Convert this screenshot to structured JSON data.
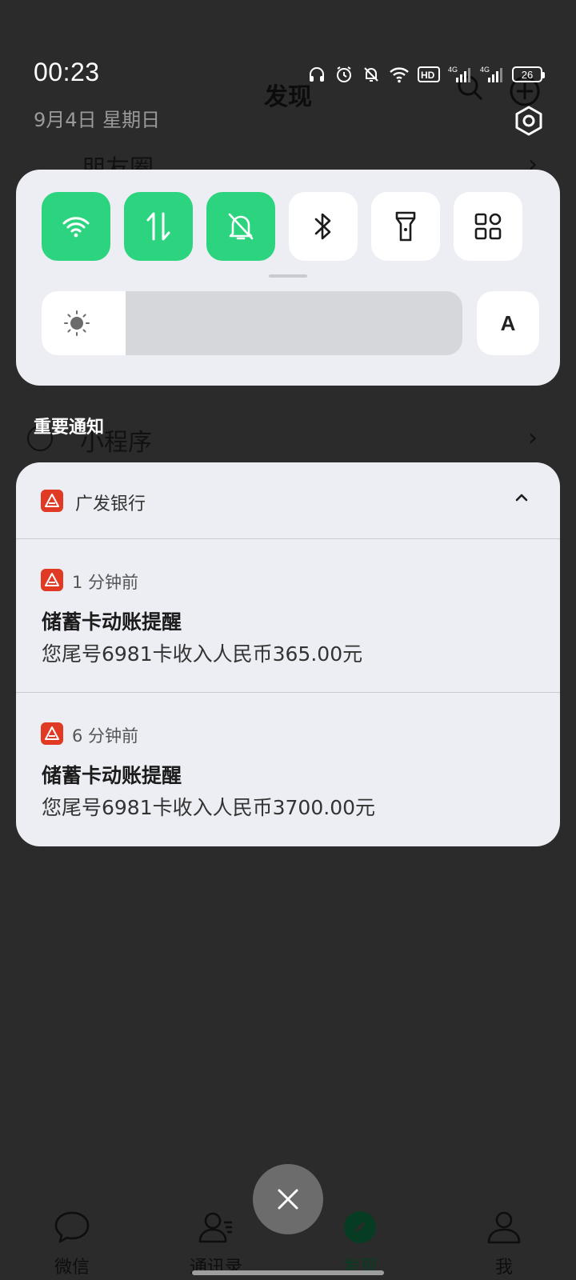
{
  "background_app": {
    "title": "发现",
    "rows": [
      {
        "label": "朋友圈"
      },
      {
        "label": "小程序"
      }
    ]
  },
  "status_bar": {
    "time": "00:23",
    "date": "9月4日  星期日",
    "battery": "26",
    "network_1": "4G",
    "network_2": "4G",
    "hd_badge": "HD"
  },
  "quick_settings": {
    "tiles": [
      {
        "name": "wifi",
        "active": true,
        "icon": "wifi-icon"
      },
      {
        "name": "mobile-data",
        "active": true,
        "icon": "data-transfer-icon"
      },
      {
        "name": "do-not-disturb",
        "active": true,
        "icon": "bell-off-icon"
      },
      {
        "name": "bluetooth",
        "active": false,
        "icon": "bluetooth-icon"
      },
      {
        "name": "flashlight",
        "active": false,
        "icon": "flashlight-icon"
      },
      {
        "name": "more",
        "active": false,
        "icon": "grid-icon"
      }
    ],
    "brightness_level": 0.2,
    "auto_brightness_label": "A"
  },
  "notifications": {
    "section_title": "重要通知",
    "app_name": "广发银行",
    "items": [
      {
        "time": "1 分钟前",
        "title": "储蓄卡动账提醒",
        "body": "您尾号6981卡收入人民币365.00元"
      },
      {
        "time": "6 分钟前",
        "title": "储蓄卡动账提醒",
        "body": "您尾号6981卡收入人民币3700.00元"
      }
    ]
  },
  "bottom_nav": {
    "tabs": [
      {
        "label": "微信",
        "active": false
      },
      {
        "label": "通讯录",
        "active": false
      },
      {
        "label": "发现",
        "active": true
      },
      {
        "label": "我",
        "active": false
      }
    ]
  },
  "colors": {
    "accent_green": "#2dd47f",
    "panel_bg": "#eceef3",
    "scrim": "#2b2b2b",
    "bank_red": "#e03a25"
  }
}
